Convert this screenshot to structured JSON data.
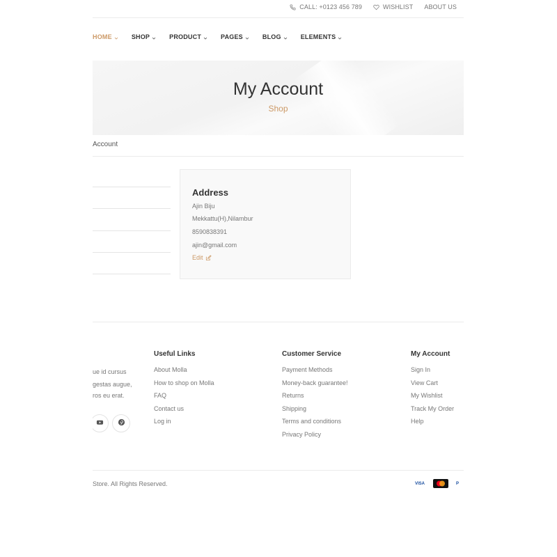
{
  "topbar": {
    "call": "CALL: +0123 456 789",
    "wishlist": "WISHLIST",
    "about": "ABOUT US"
  },
  "nav": {
    "items": [
      "HOME",
      "SHOP",
      "PRODUCT",
      "PAGES",
      "BLOG",
      "ELEMENTS"
    ],
    "active": "HOME"
  },
  "page_header": {
    "title": "My Account",
    "subtitle": "Shop"
  },
  "breadcrumb": "Account",
  "address": {
    "heading": "Address",
    "name": "Ajin Biju",
    "street": "Mekkattu(H),Nilambur",
    "phone": "8590838391",
    "email": "ajin@gmail.com",
    "edit": "Edit"
  },
  "footer": {
    "about_lines": [
      "ue id cursus",
      "gestas augue,",
      "ros eu erat."
    ],
    "social": [
      "youtube-icon",
      "pinterest-icon"
    ],
    "useful_links": {
      "title": "Useful Links",
      "items": [
        "About Molla",
        "How to shop on Molla",
        "FAQ",
        "Contact us",
        "Log in"
      ]
    },
    "customer_service": {
      "title": "Customer Service",
      "items": [
        "Payment Methods",
        "Money-back guarantee!",
        "Returns",
        "Shipping",
        "Terms and conditions",
        "Privacy Policy"
      ]
    },
    "my_account": {
      "title": "My Account",
      "items": [
        "Sign In",
        "View Cart",
        "My Wishlist",
        "Track My Order",
        "Help"
      ]
    },
    "copyright": "Store. All Rights Reserved.",
    "payments": [
      "VISA",
      "",
      "P"
    ]
  },
  "colors": {
    "accent": "#cc9966",
    "text_dark": "#333333",
    "text_muted": "#777777"
  }
}
